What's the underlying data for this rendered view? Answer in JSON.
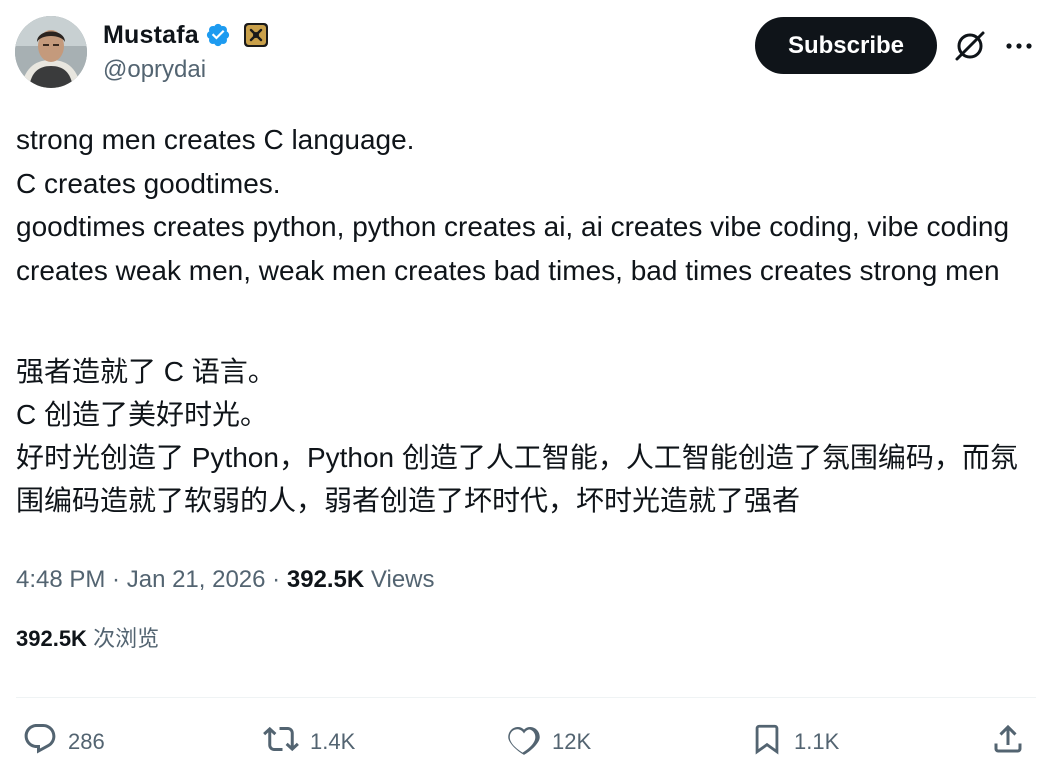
{
  "author": {
    "name": "Mustafa",
    "handle": "@oprydai",
    "verified_color": "#1d9bf0"
  },
  "header": {
    "subscribe_label": "Subscribe",
    "grok_icon": "grok-icon",
    "more_icon": "more-icon"
  },
  "tweet": {
    "lines_en": [
      "strong men creates C language.",
      "C creates goodtimes.",
      "goodtimes creates python, python creates ai, ai creates vibe coding, vibe coding creates weak men, weak men creates bad times, bad times creates strong men"
    ],
    "lines_cn": [
      "强者造就了 C 语言。",
      "C 创造了美好时光。",
      "好时光创造了 Python，Python 创造了人工智能，人工智能创造了氛围编码，而氛围编码造就了软弱的人，弱者创造了坏时代，坏时光造就了强者"
    ]
  },
  "meta": {
    "time": "4:48 PM",
    "separator": " · ",
    "date": "Jan 21, 2026",
    "views_count": "392.5K",
    "views_label": "Views",
    "views_count_cn": "392.5K",
    "views_label_cn": "次浏览"
  },
  "actions": {
    "replies": "286",
    "reposts": "1.4K",
    "likes": "12K",
    "bookmarks": "1.1K"
  },
  "colors": {
    "text": "#0f1419",
    "secondary": "#536471",
    "verified": "#1d9bf0",
    "button_bg": "#0f1419"
  }
}
